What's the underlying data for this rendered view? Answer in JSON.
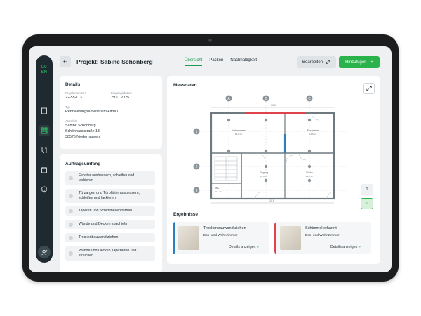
{
  "app": {
    "logo": "CO SM"
  },
  "header": {
    "back_label": "←",
    "title": "Projekt: Sabine Schönberg",
    "tabs": [
      {
        "label": "Übersicht",
        "active": true
      },
      {
        "label": "Packen",
        "active": false
      },
      {
        "label": "Nachhaltigkeit",
        "active": false
      }
    ],
    "edit_label": "Bearbeiten",
    "add_label": "Hinzufügen",
    "add_icon": "+"
  },
  "sidebar": {
    "items": [
      "document-icon",
      "layers-icon",
      "tools-icon",
      "calendar-icon",
      "tree-icon"
    ],
    "avatar_icon": "user-add-icon"
  },
  "details": {
    "title": "Details",
    "project_number_label": "Projektnummer",
    "project_number": "22-55-113",
    "date_label": "Eingangsdatum",
    "date": "29.11.2025",
    "type_label": "Typ",
    "type": "Renovierungsarbeiten im Altbau",
    "address_label": "Anschrift",
    "address_name": "Sabine Schönberg",
    "address_street": "Schönhausstraße 13",
    "address_city": "38575 Niederhausen"
  },
  "scope": {
    "title": "Auftragsumfang",
    "items": [
      {
        "line1": "Fenster ausbessern, schleifen und",
        "line2": "lackieren"
      },
      {
        "line1": "Türzargen und Türblätter ausbessern,",
        "line2": "schleifen und lackieren"
      },
      {
        "line1": "Tapeten und Schimmel entfernen",
        "line2": ""
      },
      {
        "line1": "Wände und Decken spachteln",
        "line2": ""
      },
      {
        "line1": "Trockenbauwand ziehen",
        "line2": ""
      },
      {
        "line1": "Wände und Decken Tapezieren und",
        "line2": "streichen"
      }
    ]
  },
  "measurements": {
    "title": "Messdaten",
    "axis_cols": [
      "A",
      "B",
      "C"
    ],
    "axis_rows": [
      "1",
      "2",
      "3"
    ],
    "floors": [
      "1",
      "0"
    ],
    "active_floor": "0",
    "rooms": [
      {
        "name": "Wohnzimmer",
        "area": "16,8 m²"
      },
      {
        "name": "Esszimmer",
        "area": "12,6 m²"
      },
      {
        "name": "Eingang",
        "area": "14,0 m²"
      },
      {
        "name": "Küche",
        "area": "14,8 m²"
      },
      {
        "name": "WC",
        "area": "3,7 m²"
      }
    ],
    "dim_top": "10.5",
    "dim_bottom": "10.5"
  },
  "results": {
    "title": "Ergebnisse",
    "items": [
      {
        "title": "Trockenbauwand ziehen",
        "subtitle": "Ess- und Wohnzimmer",
        "link": "Details anzeigen",
        "arrow": "»",
        "color": "#2d7fc1"
      },
      {
        "title": "Schimmel erkannt",
        "subtitle": "Ess- und Wohnzimmer",
        "link": "Details anzeigen",
        "arrow": "»",
        "color": "#e0424b"
      }
    ]
  },
  "colors": {
    "accent": "#29b34a",
    "sidebar": "#1f2a30",
    "wall_red": "#e0424b",
    "wall_blue": "#2d7fc1"
  }
}
